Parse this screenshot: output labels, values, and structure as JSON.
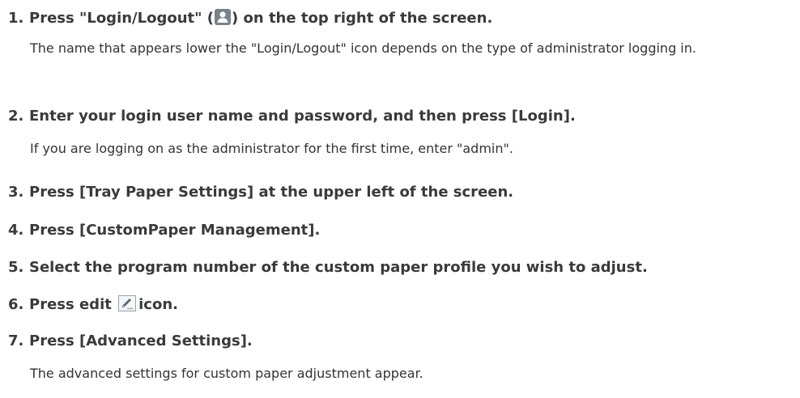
{
  "steps": [
    {
      "num": "1.",
      "pre": "Press \"Login/Logout\" (",
      "icon": "login-user-icon",
      "post": ") on the top right of the screen.",
      "note": "The name that appears lower the \"Login/Logout\" icon depends on the type of administrator logging in."
    },
    {
      "num": "2.",
      "text": "Enter your login user name and password, and then press [Login].",
      "note": "If you are logging on as the administrator for the first time, enter \"admin\"."
    },
    {
      "num": "3.",
      "text": "Press [Tray Paper Settings] at the upper left of the screen."
    },
    {
      "num": "4.",
      "text": "Press [CustomPaper Management]."
    },
    {
      "num": "5.",
      "text": "Select the program number of the custom paper profile you wish to adjust."
    },
    {
      "num": "6.",
      "pre": "Press edit",
      "icon": "edit-pencil-icon",
      "post": "icon."
    },
    {
      "num": "7.",
      "text": "Press [Advanced Settings].",
      "note": "The advanced settings for custom paper adjustment appear."
    }
  ]
}
